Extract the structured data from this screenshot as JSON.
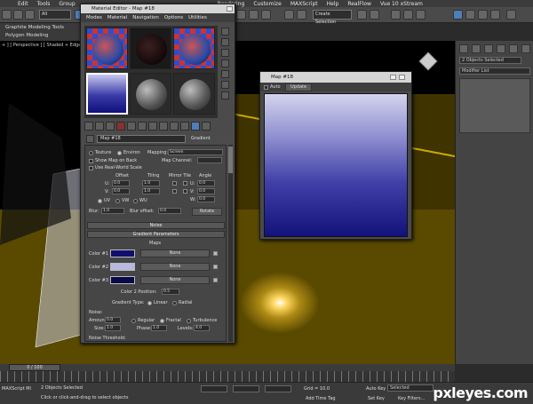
{
  "app": {
    "menu": [
      "Edit",
      "Tools",
      "Group",
      "Rendering",
      "Customize",
      "MAXScript",
      "Help",
      "RealFlow",
      "Vue 10 xStream"
    ],
    "selection_filter": "All",
    "named_selection": "Create Selection",
    "ribbon": {
      "tab": "Graphite Modeling Tools",
      "sub": "Polygon Modeling"
    },
    "viewport_label": "+ ] [ Perspective ] [ Shaded + Edged Faces ]"
  },
  "material_editor": {
    "title": "Material Editor - Map #18",
    "menu": [
      "Modes",
      "Material",
      "Navigation",
      "Options",
      "Utilities"
    ],
    "map_name": "Map #18",
    "map_type": "Gradient",
    "coordinates": {
      "texture_label": "Texture",
      "environ_label": "Environ",
      "mapping_label": "Mapping:",
      "mapping_value": "Screen",
      "show_map_on_back": "Show Map on Back",
      "map_channel_label": "Map Channel:",
      "use_real_world": "Use Real-World Scale",
      "offset_label": "Offset",
      "tiling_label": "Tiling",
      "mirror_tile_label": "Mirror Tile",
      "angle_label": "Angle",
      "u_label": "U:",
      "v_label": "V:",
      "w_label": "W:",
      "u_offset": "0.0",
      "v_offset": "0.0",
      "u_tiling": "1.0",
      "v_tiling": "1.0",
      "u_angle": "0.0",
      "v_angle": "0.0",
      "w_angle": "0.0",
      "uv_label": "UV",
      "vw_label": "VW",
      "wu_label": "WU",
      "blur_label": "Blur:",
      "blur_value": "1.0",
      "blur_offset_label": "Blur offset:",
      "blur_offset_value": "0.0",
      "rotate_label": "Rotate"
    },
    "noise_rollout": "Noise",
    "gradient_params": {
      "title": "Gradient Parameters",
      "maps_label": "Maps",
      "colors": [
        {
          "label": "Color #1",
          "hex": "#0f0f6e",
          "map": "None"
        },
        {
          "label": "Color #2",
          "hex": "#b8b8e0",
          "map": "None"
        },
        {
          "label": "Color #3",
          "hex": "#0a0a48",
          "map": "None"
        }
      ],
      "color2_position_label": "Color 2 Position:",
      "color2_position_value": "0.5",
      "gradient_type_label": "Gradient Type:",
      "linear_label": "Linear",
      "radial_label": "Radial",
      "noise_label": "Noise:",
      "amount_label": "Amount:",
      "amount_value": "0.0",
      "regular_label": "Regular",
      "fractal_label": "Fractal",
      "turbulence_label": "Turbulence",
      "size_label": "Size:",
      "size_value": "1.0",
      "phase_label": "Phase:",
      "phase_value": "1.0",
      "levels_label": "Levels:",
      "levels_value": "4.0",
      "noise_threshold_label": "Noise Threshold:"
    }
  },
  "map_window": {
    "title": "Map #18",
    "auto_label": "Auto",
    "update_label": "Update"
  },
  "command_panel": {
    "selection": "2 Objects Selected",
    "modifier_list": "Modifier List"
  },
  "time": {
    "slider": "0 / 100"
  },
  "status": {
    "objects": "2 Objects Selected",
    "prompt": "Click or click-and-drag to select objects",
    "maxscript": "MAXScript Mi",
    "grid": "Grid = 10.0",
    "add_time_tag": "Add Time Tag",
    "auto_key": "Auto Key",
    "selected": "Selected",
    "set_key": "Set Key",
    "key_filters": "Key Filters..."
  },
  "watermark": "pxleyes.com",
  "colors": {
    "gradient_top": "#d4d4ee",
    "gradient_bottom": "#12127a",
    "accent": "#4e7fb8"
  }
}
